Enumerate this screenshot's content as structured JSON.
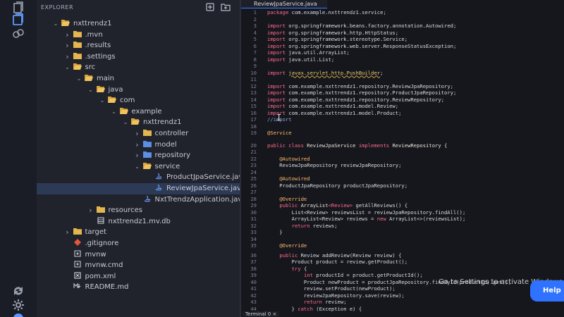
{
  "explorer": {
    "title": "EXPLORER",
    "tree": [
      {
        "label": "nxttrendz1",
        "kind": "folder-open",
        "depth": 0,
        "chev": "v"
      },
      {
        "label": ".mvn",
        "kind": "folder",
        "depth": 1,
        "chev": ">"
      },
      {
        "label": ".results",
        "kind": "folder",
        "depth": 1,
        "chev": ">"
      },
      {
        "label": ".settings",
        "kind": "folder",
        "depth": 1,
        "chev": ">"
      },
      {
        "label": "src",
        "kind": "folder-open",
        "depth": 1,
        "chev": "v"
      },
      {
        "label": "main",
        "kind": "folder-open",
        "depth": 2,
        "chev": "v"
      },
      {
        "label": "java",
        "kind": "folder-open",
        "depth": 3,
        "chev": "v"
      },
      {
        "label": "com",
        "kind": "folder-open",
        "depth": 4,
        "chev": "v"
      },
      {
        "label": "example",
        "kind": "folder-open",
        "depth": 5,
        "chev": "v"
      },
      {
        "label": "nxttrendz1",
        "kind": "folder-open",
        "depth": 6,
        "chev": "v"
      },
      {
        "label": "controller",
        "kind": "folder",
        "depth": 7,
        "chev": ">"
      },
      {
        "label": "model",
        "kind": "folder-blue",
        "depth": 7,
        "chev": ">"
      },
      {
        "label": "repository",
        "kind": "folder-blue",
        "depth": 7,
        "chev": ">"
      },
      {
        "label": "service",
        "kind": "folder-open",
        "depth": 7,
        "chev": "v"
      },
      {
        "label": "ProductJpaService.java",
        "kind": "java",
        "depth": 8,
        "chev": ""
      },
      {
        "label": "ReviewJpaService.java",
        "kind": "java",
        "depth": 8,
        "chev": "",
        "selected": true
      },
      {
        "label": "NxtTrendzApplication.java",
        "kind": "java",
        "depth": 7,
        "chev": ""
      },
      {
        "label": "resources",
        "kind": "folder",
        "depth": 3,
        "chev": ">"
      },
      {
        "label": "nxttrendz1.mv.db",
        "kind": "db",
        "depth": 3,
        "chev": ""
      },
      {
        "label": "target",
        "kind": "folder",
        "depth": 1,
        "chev": ">"
      },
      {
        "label": ".gitignore",
        "kind": "git",
        "depth": 1,
        "chev": ""
      },
      {
        "label": "mvnw",
        "kind": "file",
        "depth": 1,
        "chev": ""
      },
      {
        "label": "mvnw.cmd",
        "kind": "file",
        "depth": 1,
        "chev": ""
      },
      {
        "label": "pom.xml",
        "kind": "xml",
        "depth": 1,
        "chev": ""
      },
      {
        "label": "README.md",
        "kind": "md",
        "depth": 1,
        "chev": ""
      }
    ]
  },
  "editor": {
    "tab_label": "ReviewJpaService.java",
    "lines": [
      {
        "n": "1",
        "segs": [
          [
            "kw",
            "package "
          ],
          [
            "pl",
            "com.example.nxttrendz1.service;"
          ]
        ]
      },
      {
        "n": "2",
        "segs": []
      },
      {
        "n": "3",
        "segs": [
          [
            "kw",
            "import "
          ],
          [
            "pl",
            "org.springframework.beans.factory.annotation.Autowired;"
          ]
        ]
      },
      {
        "n": "4",
        "segs": [
          [
            "kw",
            "import "
          ],
          [
            "pl",
            "org.springframework.http.HttpStatus;"
          ]
        ]
      },
      {
        "n": "5",
        "segs": [
          [
            "kw",
            "import "
          ],
          [
            "pl",
            "org.springframework.stereotype.Service;"
          ]
        ]
      },
      {
        "n": "6",
        "segs": [
          [
            "kw",
            "import "
          ],
          [
            "pl",
            "org.springframework.web.server.ResponseStatusException;"
          ]
        ]
      },
      {
        "n": "7",
        "segs": [
          [
            "kw",
            "import "
          ],
          [
            "pl",
            "java.util.ArrayList;"
          ]
        ]
      },
      {
        "n": "8",
        "segs": [
          [
            "kw",
            "import "
          ],
          [
            "pl",
            "java.util.List;"
          ]
        ]
      },
      {
        "n": "9",
        "segs": []
      },
      {
        "n": "10",
        "segs": [
          [
            "kw",
            "import "
          ],
          [
            "warn",
            "javax.servlet.http.PushBuilder"
          ],
          [
            "pl",
            ";"
          ]
        ]
      },
      {
        "n": "11",
        "segs": []
      },
      {
        "n": "12",
        "segs": [
          [
            "kw",
            "import "
          ],
          [
            "pl",
            "com.example.nxttrendz1.repository.ReviewJpaRepository;"
          ]
        ]
      },
      {
        "n": "13",
        "segs": [
          [
            "kw",
            "import "
          ],
          [
            "pl",
            "com.example.nxttrendz1.repository.ProductJpaRepository;"
          ]
        ]
      },
      {
        "n": "14",
        "segs": [
          [
            "kw",
            "import "
          ],
          [
            "pl",
            "com.example.nxttrendz1.repository.ReviewRepository;"
          ]
        ]
      },
      {
        "n": "15",
        "segs": [
          [
            "kw",
            "import "
          ],
          [
            "pl",
            "com.example.nxttrendz1.model.Review;"
          ]
        ]
      },
      {
        "n": "16",
        "segs": [
          [
            "kw",
            "import "
          ],
          [
            "pl",
            "com.example.nxttrendz1.model.Product;"
          ]
        ]
      },
      {
        "n": "17",
        "segs": [
          [
            "cm",
            "//import"
          ]
        ]
      },
      {
        "n": "18",
        "segs": []
      },
      {
        "n": "19",
        "segs": [
          [
            "an",
            "@Service"
          ]
        ]
      },
      {
        "n": "20",
        "segs": [
          [
            "kw",
            "public class "
          ],
          [
            "ty",
            "ReviewJpaService "
          ],
          [
            "kw",
            "implements "
          ],
          [
            "ty",
            "ReviewRepository {"
          ]
        ]
      },
      {
        "n": "21",
        "segs": []
      },
      {
        "n": "22",
        "segs": [
          [
            "pl",
            "    "
          ],
          [
            "an",
            "@Autowired"
          ]
        ]
      },
      {
        "n": "23",
        "segs": [
          [
            "pl",
            "    ReviewJpaRepository reviewJpaRepository;"
          ]
        ]
      },
      {
        "n": "24",
        "segs": []
      },
      {
        "n": "25",
        "segs": [
          [
            "pl",
            "    "
          ],
          [
            "an",
            "@Autowired"
          ]
        ]
      },
      {
        "n": "26",
        "segs": [
          [
            "pl",
            "    ProductJpaRepository productJpaRepository;"
          ]
        ]
      },
      {
        "n": "27",
        "segs": []
      },
      {
        "n": "28",
        "segs": [
          [
            "pl",
            "    "
          ],
          [
            "an",
            "@Override"
          ]
        ]
      },
      {
        "n": "29",
        "segs": [
          [
            "pl",
            "    "
          ],
          [
            "kw",
            "public "
          ],
          [
            "ty",
            "ArrayList"
          ],
          [
            "kw",
            "<Review> "
          ],
          [
            "pl",
            "getAllReviews() {"
          ]
        ]
      },
      {
        "n": "30",
        "segs": [
          [
            "pl",
            "        List<Review> reviewsList = reviewJpaRepository.findAll();"
          ]
        ]
      },
      {
        "n": "31",
        "segs": [
          [
            "pl",
            "        ArrayList<Review> reviews = "
          ],
          [
            "kw",
            "new "
          ],
          [
            "pl",
            "ArrayList<>(reviewsList);"
          ]
        ]
      },
      {
        "n": "32",
        "segs": [
          [
            "pl",
            "        "
          ],
          [
            "kw",
            "return "
          ],
          [
            "pl",
            "reviews;"
          ]
        ]
      },
      {
        "n": "33",
        "segs": [
          [
            "pl",
            "    }"
          ]
        ]
      },
      {
        "n": "34",
        "segs": []
      },
      {
        "n": "35",
        "segs": [
          [
            "pl",
            "    "
          ],
          [
            "an",
            "@Override"
          ]
        ]
      },
      {
        "n": "36",
        "segs": [
          [
            "pl",
            "    "
          ],
          [
            "kw",
            "public "
          ],
          [
            "pl",
            "Review addReview(Review review) {"
          ]
        ]
      },
      {
        "n": "37",
        "segs": [
          [
            "pl",
            "        Product product = review.getProduct();"
          ]
        ]
      },
      {
        "n": "38",
        "segs": [
          [
            "pl",
            "        "
          ],
          [
            "kw",
            "try "
          ],
          [
            "pl",
            "{"
          ]
        ]
      },
      {
        "n": "39",
        "segs": [
          [
            "pl",
            "            "
          ],
          [
            "kw",
            "int "
          ],
          [
            "pl",
            "productId = product.getProductId();"
          ]
        ]
      },
      {
        "n": "40",
        "segs": [
          [
            "pl",
            "            Product newProduct = productJpaRepository.findById(productId).get();"
          ]
        ]
      },
      {
        "n": "41",
        "segs": [
          [
            "pl",
            "            review.setProduct(newProduct);"
          ]
        ]
      },
      {
        "n": "42",
        "segs": [
          [
            "pl",
            "            reviewJpaRepository.save(review);"
          ]
        ]
      },
      {
        "n": "43",
        "segs": [
          [
            "pl",
            "            "
          ],
          [
            "kw",
            "return "
          ],
          [
            "pl",
            "review;"
          ]
        ]
      },
      {
        "n": "44",
        "segs": [
          [
            "pl",
            "        } "
          ],
          [
            "kw",
            "catch "
          ],
          [
            "pl",
            "(Exception e) {"
          ]
        ]
      }
    ]
  },
  "overlay": {
    "activation_text": "Go to Settings to activate Windows.",
    "help_label": "Help"
  },
  "terminal": {
    "label": "Terminal  0  ×"
  }
}
